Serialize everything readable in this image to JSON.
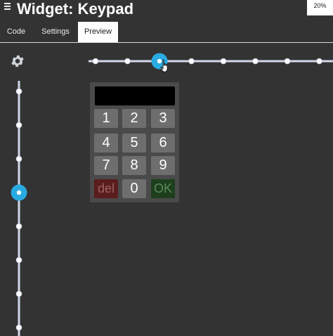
{
  "header": {
    "title": "Widget: Keypad",
    "zoom": "20%"
  },
  "tabs": [
    {
      "label": "Code",
      "active": false
    },
    {
      "label": "Settings",
      "active": false
    },
    {
      "label": "Preview",
      "active": true
    }
  ],
  "keypad": {
    "display": "",
    "keys": [
      [
        "1",
        "2",
        "3"
      ],
      [
        "4",
        "5",
        "6"
      ],
      [
        "7",
        "8",
        "9"
      ],
      [
        "del",
        "0",
        "OK"
      ]
    ]
  },
  "sliders": {
    "horizontal": {
      "steps": 8,
      "selected_step": 2
    },
    "vertical": {
      "steps": 8,
      "selected_step": 3
    }
  },
  "colors": {
    "background": "#333333",
    "accent": "#29abe2",
    "track": "#d0d8e8",
    "key": "#6e6e6e",
    "del": "#5a1c1c",
    "ok": "#1d3f1d"
  },
  "icons": {
    "menu": "hamburger-icon",
    "settings": "gear-icon",
    "cursor": "hand-pointer-icon"
  }
}
